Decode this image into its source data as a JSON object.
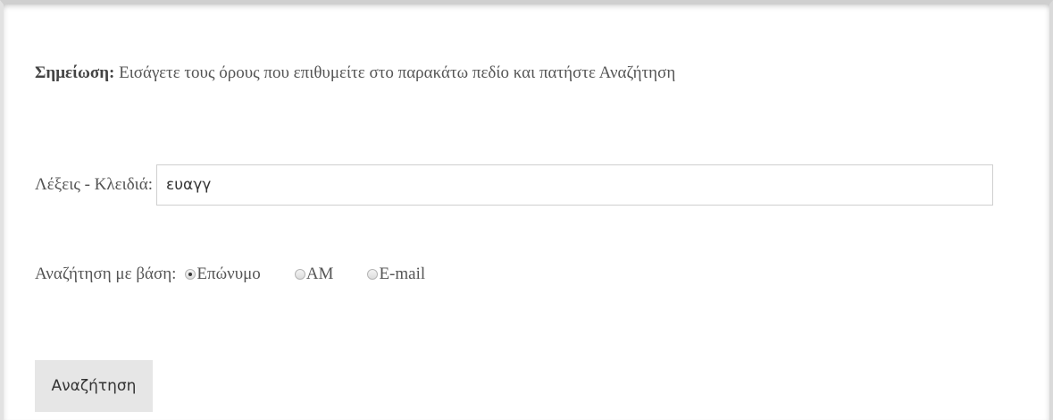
{
  "note": {
    "bold_label": "Σημείωση:",
    "text": " Εισάγετε τους όρους που επιθυμείτε στο παρακάτω πεδίο και πατήστε Αναζήτηση"
  },
  "keywords": {
    "label": "Λέξεις - Κλειδιά:",
    "value": "ευαγγ"
  },
  "search_by": {
    "label": "Αναζήτηση με βάση:",
    "selected": "Επώνυμο",
    "options": [
      {
        "label": "Επώνυμο",
        "checked": true
      },
      {
        "label": "ΑΜ",
        "checked": false
      },
      {
        "label": "E-mail",
        "checked": false
      }
    ]
  },
  "search_button": {
    "label": "Αναζήτηση"
  }
}
